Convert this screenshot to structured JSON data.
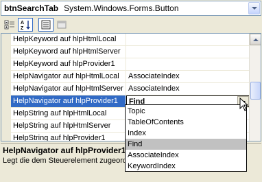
{
  "selector": {
    "object_name": "btnSearchTab",
    "object_type": "System.Windows.Forms.Button"
  },
  "toolbar": {
    "icons": [
      "categorized-icon",
      "alphabetical-icon",
      "properties-icon",
      "events-icon"
    ]
  },
  "grid": {
    "rows": [
      {
        "name": "HelpKeyword auf hlpHtmlLocal",
        "value": ""
      },
      {
        "name": "HelpKeyword auf hlpHtmlServer",
        "value": ""
      },
      {
        "name": "HelpKeyword auf hlpProvider1",
        "value": ""
      },
      {
        "name": "HelpNavigator auf hlpHtmlLocal",
        "value": "AssociateIndex"
      },
      {
        "name": "HelpNavigator auf hlpHtmlServer",
        "value": "AssociateIndex"
      },
      {
        "name": "HelpNavigator auf hlpProvider1",
        "value": "Find"
      },
      {
        "name": "HelpString auf hlpHtmlLocal",
        "value": ""
      },
      {
        "name": "HelpString auf hlpHtmlServer",
        "value": ""
      },
      {
        "name": "HelpString auf hlpProvider1",
        "value": ""
      }
    ],
    "selected_index": 5
  },
  "dropdown": {
    "options": [
      "Topic",
      "TableOfContents",
      "Index",
      "Find",
      "AssociateIndex",
      "KeywordIndex"
    ],
    "selected": "Find"
  },
  "help": {
    "title": "HelpNavigator auf hlpProvider1",
    "description": "Legt die dem Steuerelement zugeord"
  }
}
